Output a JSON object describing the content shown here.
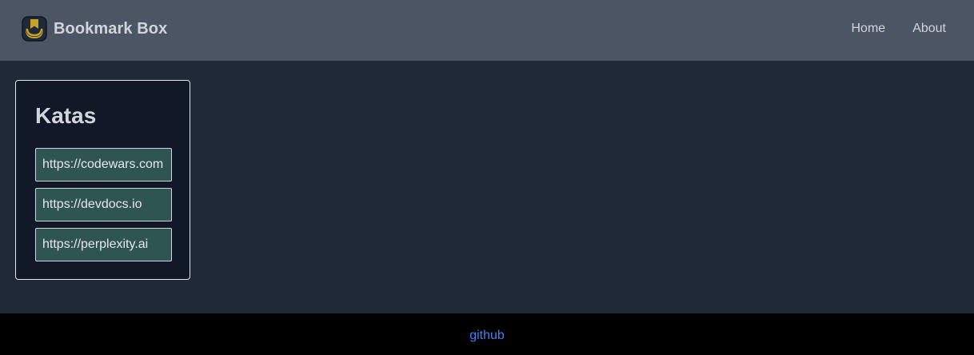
{
  "header": {
    "brand": "Bookmark Box",
    "logo_icon": "bookmark-box-logo-icon",
    "nav": [
      {
        "label": "Home"
      },
      {
        "label": "About"
      }
    ]
  },
  "main": {
    "cards": [
      {
        "title": "Katas",
        "links": [
          {
            "label": "https://codewars.com"
          },
          {
            "label": "https://devdocs.io"
          },
          {
            "label": "https://perplexity.ai"
          }
        ]
      }
    ]
  },
  "footer": {
    "link": "github"
  },
  "colors": {
    "navbar_bg": "#4b5563",
    "page_bg": "#1f2937",
    "card_bg": "#111827",
    "link_bg": "#2f5550",
    "footer_bg": "#000000",
    "footer_link": "#3b82f6",
    "logo_gold": "#c9a227"
  }
}
